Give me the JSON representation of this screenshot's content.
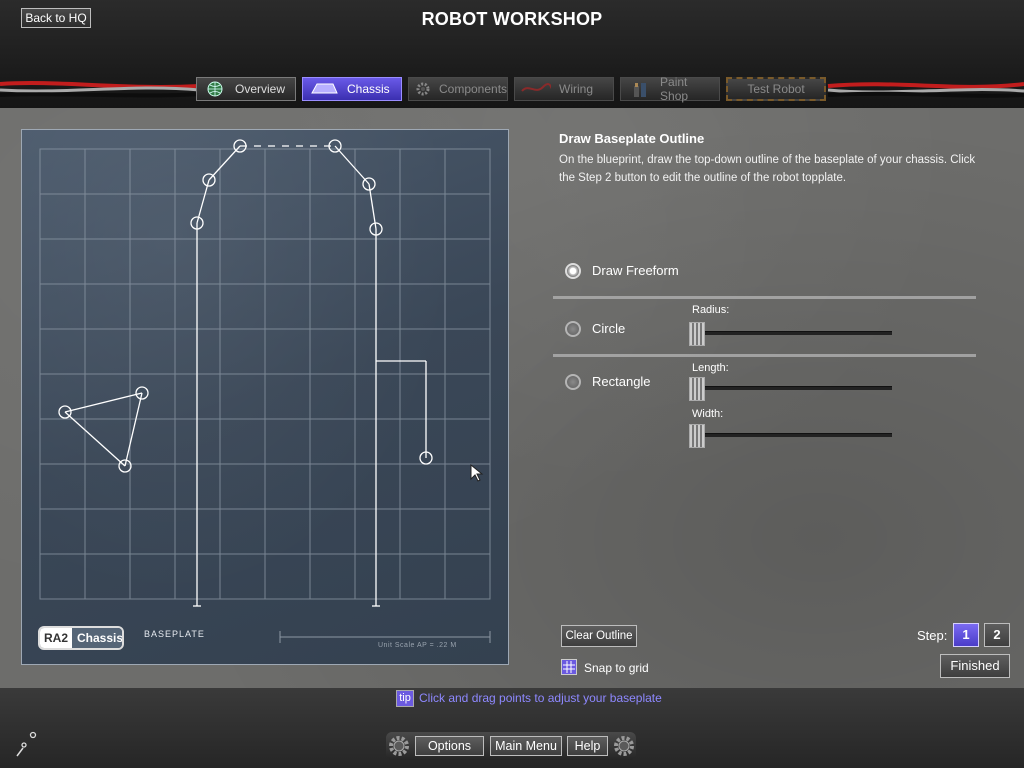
{
  "header": {
    "back_label": "Back to HQ",
    "title": "ROBOT WORKSHOP"
  },
  "tabs": [
    {
      "label": "Overview",
      "icon": "globe-icon",
      "state": "normal"
    },
    {
      "label": "Chassis",
      "icon": "chassis-icon",
      "state": "active"
    },
    {
      "label": "Components",
      "icon": "gear-icon",
      "state": "disabled"
    },
    {
      "label": "Wiring",
      "icon": "wire-icon",
      "state": "disabled"
    },
    {
      "label": "Paint Shop",
      "icon": "paint-icon",
      "state": "disabled"
    },
    {
      "label": "Test Robot",
      "icon": "none",
      "state": "disabled"
    }
  ],
  "blueprint": {
    "logo_a": "RA2",
    "logo_b": "Chassis",
    "label": "BASEPLATE",
    "scale_text": "Unit Scale     AP = .22 M"
  },
  "panel": {
    "heading": "Draw Baseplate Outline",
    "description": "On the blueprint, draw the top-down outline of the baseplate of your chassis. Click the Step 2 button to edit the outline of the robot topplate.",
    "options": [
      {
        "label": "Draw Freeform",
        "selected": true
      },
      {
        "label": "Circle",
        "selected": false
      },
      {
        "label": "Rectangle",
        "selected": false
      }
    ],
    "sliders": {
      "radius_label": "Radius:",
      "length_label": "Length:",
      "width_label": "Width:",
      "radius": 0,
      "length": 0,
      "width": 0
    },
    "clear_label": "Clear Outline",
    "snap_label": "Snap to grid",
    "snap_on": true,
    "step_label": "Step:",
    "step1": "1",
    "step2": "2",
    "current_step": 1,
    "finished_label": "Finished"
  },
  "footer": {
    "tip_icon": "tip",
    "tip_text": "Click and drag points to adjust your baseplate",
    "options_label": "Options",
    "main_menu_label": "Main Menu",
    "help_label": "Help"
  },
  "colors": {
    "accent": "#6b5ae0",
    "blueprint": "#3e4b5b",
    "tip_text": "#8e88ff"
  }
}
